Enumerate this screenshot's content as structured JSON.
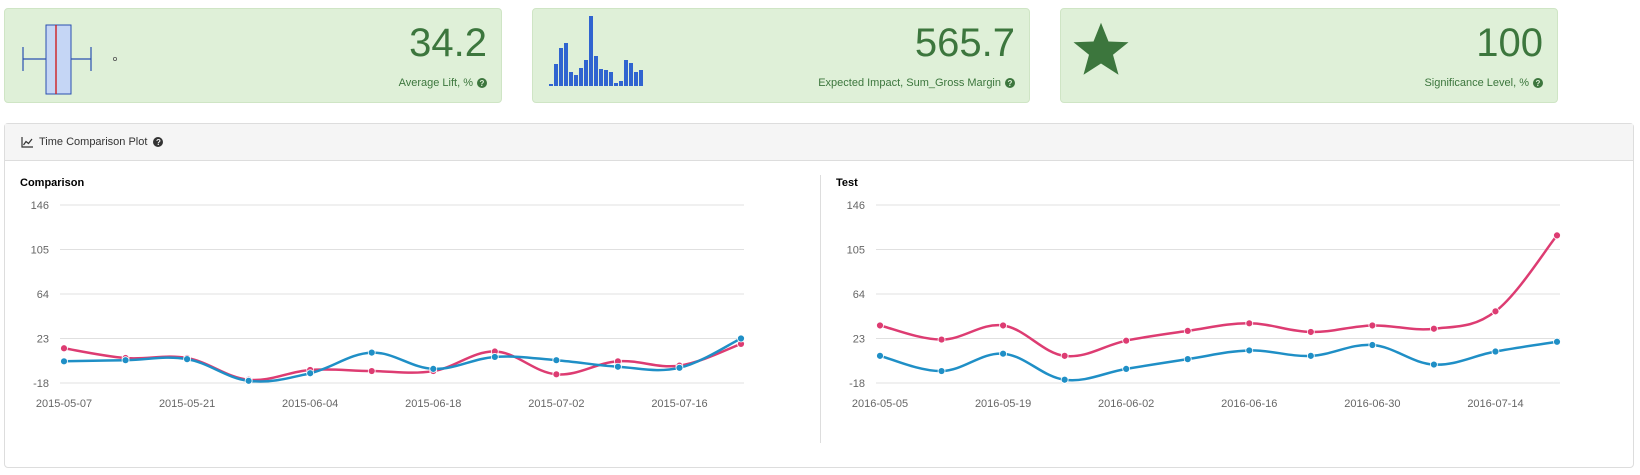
{
  "kpis": [
    {
      "value": "34.2",
      "label": "Average Lift, %",
      "icon": "boxplot-icon"
    },
    {
      "value": "565.7",
      "label": "Expected Impact, Sum_Gross Margin",
      "icon": "histogram-icon"
    },
    {
      "value": "100",
      "label": "Significance Level, %",
      "icon": "star-icon"
    }
  ],
  "panel": {
    "title": "Time Comparison Plot"
  },
  "colors": {
    "series_a": "#dd3c72",
    "series_b": "#1f8fc6",
    "kpi_bg": "#dff0d8",
    "kpi_text": "#3c763d"
  },
  "chart_data": [
    {
      "type": "line",
      "title": "Comparison",
      "yticks": [
        146,
        105,
        64,
        23,
        -18
      ],
      "ylim": [
        -18,
        146
      ],
      "x": [
        "2015-05-07",
        "2015-05-14",
        "2015-05-21",
        "2015-05-28",
        "2015-06-04",
        "2015-06-11",
        "2015-06-18",
        "2015-06-25",
        "2015-07-02",
        "2015-07-09",
        "2015-07-16",
        "2015-07-23"
      ],
      "xtick_labels": [
        "2015-05-07",
        "2015-05-21",
        "2015-06-04",
        "2015-06-18",
        "2015-07-02",
        "2015-07-16"
      ],
      "series": [
        {
          "values": [
            14,
            5,
            5,
            -15,
            -6,
            -7,
            -7,
            11,
            -10,
            2,
            -2,
            18
          ]
        },
        {
          "values": [
            2,
            3,
            4,
            -16,
            -9,
            10,
            -5,
            6,
            3,
            -3,
            -4,
            23
          ]
        }
      ],
      "grid": true
    },
    {
      "type": "line",
      "title": "Test",
      "yticks": [
        146,
        105,
        64,
        23,
        -18
      ],
      "ylim": [
        -18,
        146
      ],
      "x": [
        "2016-05-05",
        "2016-05-12",
        "2016-05-19",
        "2016-05-26",
        "2016-06-02",
        "2016-06-09",
        "2016-06-16",
        "2016-06-23",
        "2016-06-30",
        "2016-07-07",
        "2016-07-14",
        "2016-07-21"
      ],
      "xtick_labels": [
        "2016-05-05",
        "2016-05-19",
        "2016-06-02",
        "2016-06-16",
        "2016-06-30",
        "2016-07-14"
      ],
      "series": [
        {
          "values": [
            35,
            22,
            35,
            7,
            21,
            30,
            37,
            29,
            35,
            32,
            48,
            118
          ]
        },
        {
          "values": [
            7,
            -7,
            9,
            -15,
            -5,
            4,
            12,
            7,
            17,
            -1,
            11,
            20
          ]
        }
      ],
      "grid": true
    }
  ]
}
